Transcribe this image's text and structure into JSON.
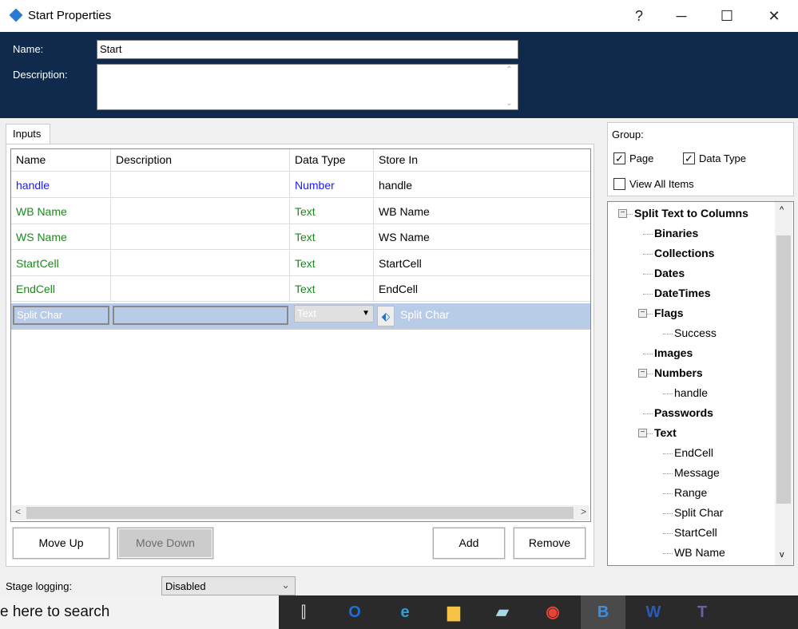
{
  "window": {
    "title": "Start Properties",
    "help": "?",
    "minimize": "─",
    "maximize": "☐",
    "close": "✕"
  },
  "header": {
    "name_label": "Name:",
    "name_value": "Start",
    "description_label": "Description:",
    "description_value": ""
  },
  "tabs": [
    {
      "label": "Inputs"
    }
  ],
  "grid": {
    "columns": [
      "Name",
      "Description",
      "Data Type",
      "Store In"
    ],
    "rows": [
      {
        "name": "handle",
        "description": "",
        "type": "Number",
        "store": "handle",
        "color": "#1a1aff"
      },
      {
        "name": "WB Name",
        "description": "",
        "type": "Text",
        "store": "WB Name",
        "color": "#1a8a1a"
      },
      {
        "name": "WS Name",
        "description": "",
        "type": "Text",
        "store": "WS Name",
        "color": "#1a8a1a"
      },
      {
        "name": "StartCell",
        "description": "",
        "type": "Text",
        "store": "StartCell",
        "color": "#1a8a1a"
      },
      {
        "name": "EndCell",
        "description": "",
        "type": "Text",
        "store": "EndCell",
        "color": "#1a8a1a"
      }
    ],
    "edit_row": {
      "name": "Split Char",
      "description": "",
      "type": "Text",
      "store": "Split Char"
    }
  },
  "buttons": {
    "move_up": "Move Up",
    "move_down": "Move Down",
    "add": "Add",
    "remove": "Remove"
  },
  "group": {
    "label": "Group:",
    "page": {
      "label": "Page",
      "checked": true
    },
    "data_type": {
      "label": "Data Type",
      "checked": true
    },
    "view_all": {
      "label": "View All Items",
      "checked": false
    }
  },
  "tree": [
    {
      "label": "Split Text to Columns",
      "level": 0,
      "expanded": true
    },
    {
      "label": "Binaries",
      "level": 1
    },
    {
      "label": "Collections",
      "level": 1
    },
    {
      "label": "Dates",
      "level": 1
    },
    {
      "label": "DateTimes",
      "level": 1
    },
    {
      "label": "Flags",
      "level": 1,
      "expanded": true
    },
    {
      "label": "Success",
      "level": 2
    },
    {
      "label": "Images",
      "level": 1
    },
    {
      "label": "Numbers",
      "level": 1,
      "expanded": true
    },
    {
      "label": "handle",
      "level": 2
    },
    {
      "label": "Passwords",
      "level": 1
    },
    {
      "label": "Text",
      "level": 1,
      "expanded": true
    },
    {
      "label": "EndCell",
      "level": 2
    },
    {
      "label": "Message",
      "level": 2
    },
    {
      "label": "Range",
      "level": 2
    },
    {
      "label": "Split Char",
      "level": 2
    },
    {
      "label": "StartCell",
      "level": 2
    },
    {
      "label": "WB Name",
      "level": 2
    }
  ],
  "stage_logging": {
    "label": "Stage logging:",
    "value": "Disabled"
  },
  "taskbar": {
    "search_placeholder": "e here to search",
    "apps": [
      "task-view",
      "outlook",
      "edge",
      "file-explorer",
      "notepad",
      "chrome",
      "blue-prism",
      "word",
      "teams"
    ]
  }
}
